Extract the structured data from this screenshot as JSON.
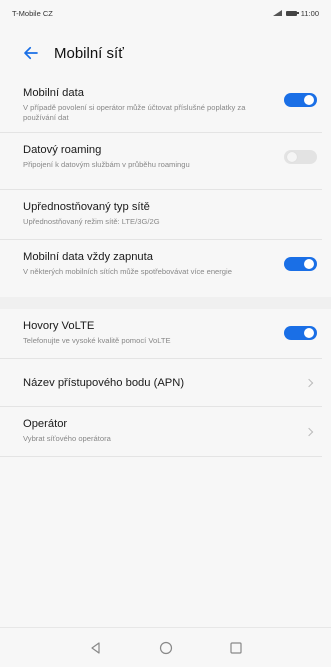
{
  "status": {
    "carrier": "T-Mobile CZ",
    "time": "11:00"
  },
  "header": {
    "title": "Mobilní síť"
  },
  "items": [
    {
      "title": "Mobilní data",
      "subtitle": "V případě povolení si operátor může účtovat příslušné poplatky za používání dat",
      "toggle": "on"
    },
    {
      "title": "Datový roaming",
      "subtitle": "Připojení k datovým službám v průběhu roamingu",
      "toggle": "off"
    },
    {
      "title": "Upřednostňovaný typ sítě",
      "subtitle": "Upřednostňovaný režim sítě: LTE/3G/2G"
    },
    {
      "title": "Mobilní data vždy zapnuta",
      "subtitle": "V některých mobilních sítích může spotřebovávat více energie",
      "toggle": "on"
    },
    {
      "title": "Hovory VoLTE",
      "subtitle": "Telefonujte ve vysoké kvalitě pomocí VoLTE",
      "toggle": "on"
    },
    {
      "title": "Název přístupového bodu (APN)"
    },
    {
      "title": "Operátor",
      "subtitle": "Vybrat síťového operátora"
    }
  ],
  "colors": {
    "accent": "#1a6fe6",
    "toggle_off": "#e3e3e3"
  },
  "nav": {
    "back": "back-triangle-icon",
    "home": "home-circle-icon",
    "recents": "recents-square-icon"
  }
}
